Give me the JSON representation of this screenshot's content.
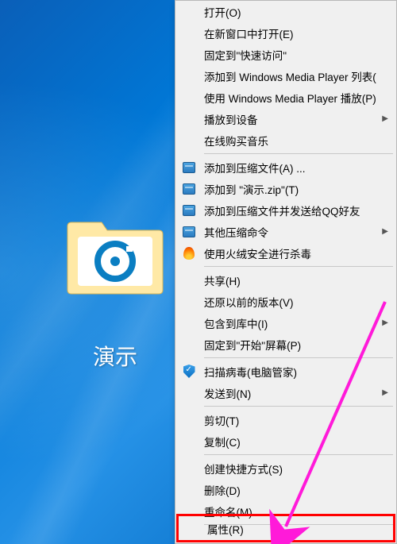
{
  "desktop": {
    "folder_label": "演示"
  },
  "menu": {
    "open": "打开(O)",
    "open_new_window": "在新窗口中打开(E)",
    "pin_quick_access": "固定到\"快速访问\"",
    "add_wmp_list": "添加到 Windows Media Player 列表(",
    "play_wmp": "使用 Windows Media Player 播放(P)",
    "cast_device": "播放到设备",
    "buy_music_online": "在线购买音乐",
    "add_archive": "添加到压缩文件(A) ...",
    "add_archive_named": "添加到 \"演示.zip\"(T)",
    "add_archive_send_qq": "添加到压缩文件并发送给QQ好友",
    "other_compress": "其他压缩命令",
    "huorong_scan": "使用火绒安全进行杀毒",
    "share": "共享(H)",
    "restore_prev": "还原以前的版本(V)",
    "include_library": "包含到库中(I)",
    "pin_start": "固定到\"开始\"屏幕(P)",
    "scan_virus": "扫描病毒(电脑管家)",
    "send_to": "发送到(N)",
    "cut": "剪切(T)",
    "copy": "复制(C)",
    "create_shortcut": "创建快捷方式(S)",
    "delete": "删除(D)",
    "rename": "重命名(M)",
    "properties": "属性(R)"
  }
}
